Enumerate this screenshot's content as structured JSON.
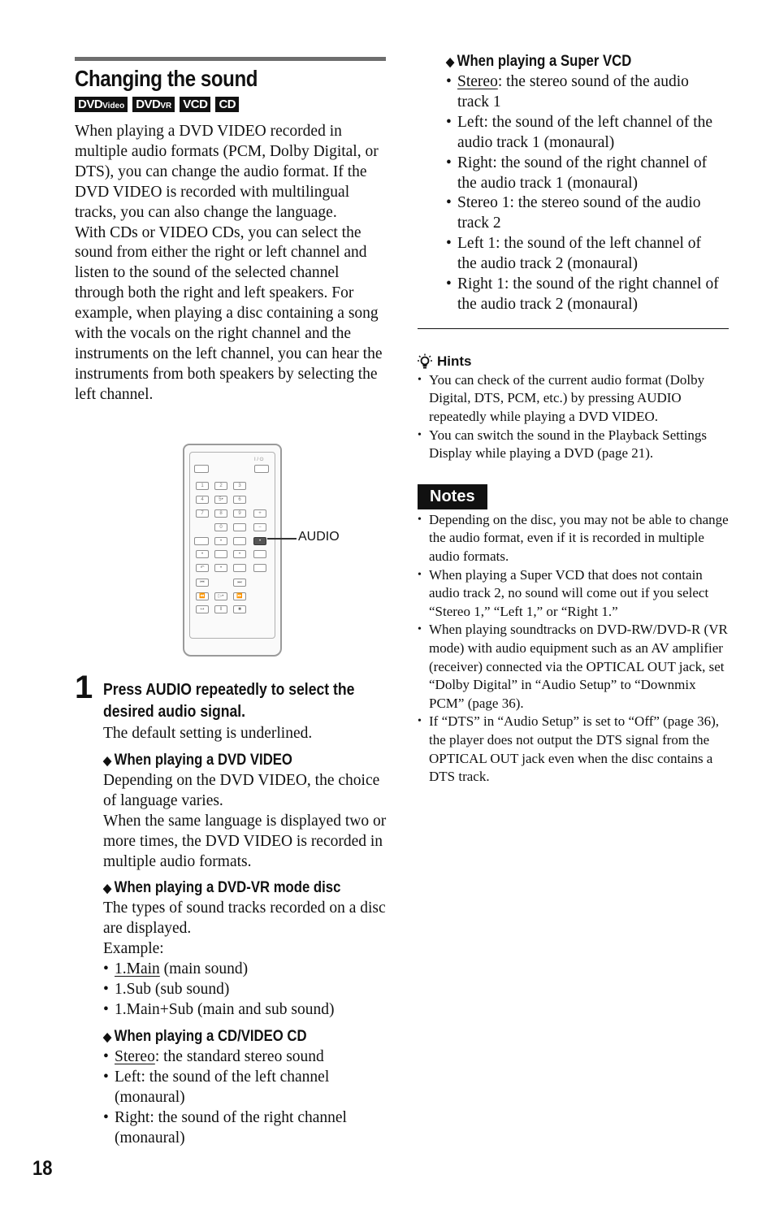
{
  "page": {
    "title": "Changing the sound",
    "page_number": "18",
    "disc_badges": [
      {
        "main": "DVD",
        "suffix": "Video"
      },
      {
        "main": "DVD",
        "suffix": "VR"
      },
      {
        "main": "VCD",
        "suffix": ""
      },
      {
        "main": "CD",
        "suffix": ""
      }
    ]
  },
  "intro": {
    "paragraph1": "When playing a DVD VIDEO recorded in multiple audio formats (PCM, Dolby Digital, or DTS), you can change the audio format. If the DVD VIDEO is recorded with multilingual tracks, you can also change the language.",
    "paragraph2": "With CDs or VIDEO CDs, you can select the sound from either the right or left channel and listen to the sound of the selected channel through both the right and left speakers. For example, when playing a disc containing a song with the vocals on the right channel and the instruments on the left channel, you can hear the instruments from both speakers by selecting the left channel."
  },
  "illustration": {
    "callout_label": "AUDIO",
    "power_label": "I / ⏻",
    "buttons": [
      "1",
      "2",
      "3",
      "4",
      "5•",
      "6",
      "7",
      "8",
      "9",
      "+",
      "0",
      "−",
      "•",
      "•",
      "•",
      "•",
      "•",
      "↶",
      "•",
      "⏮",
      "⏭",
      "⏪",
      "▷•",
      "⏩",
      "↦",
      "‖",
      "■"
    ]
  },
  "step1": {
    "number": "1",
    "title": "Press AUDIO repeatedly to select the desired audio signal.",
    "subtitle": "The default setting is underlined.",
    "dvd_video": {
      "heading": "When playing a DVD VIDEO",
      "text1": "Depending on the DVD VIDEO, the choice of language varies.",
      "text2": "When the same language is displayed two or more times, the DVD VIDEO is recorded in multiple audio formats."
    },
    "dvd_vr": {
      "heading": "When playing a DVD-VR mode disc",
      "text1": "The types of sound tracks recorded on a disc are displayed.",
      "text2": "Example:",
      "items": [
        {
          "term": "1.Main",
          "rest": " (main sound)",
          "default": true
        },
        {
          "term": "1.Sub",
          "rest": " (sub sound)",
          "default": false
        },
        {
          "term": "1.Main+Sub",
          "rest": " (main and sub sound)",
          "default": false
        }
      ]
    },
    "cd_vcd": {
      "heading": "When playing a CD/VIDEO CD",
      "items": [
        {
          "term": "Stereo",
          "rest": ": the standard stereo sound",
          "default": true
        },
        {
          "term": "Left",
          "rest": ": the sound of the left channel (monaural)",
          "default": false
        },
        {
          "term": "Right",
          "rest": ": the sound of the right channel (monaural)",
          "default": false
        }
      ]
    },
    "super_vcd": {
      "heading": "When playing a Super VCD",
      "items": [
        {
          "term": "Stereo",
          "rest": ": the stereo sound of the audio track 1",
          "default": true
        },
        {
          "term": "Left",
          "rest": ": the sound of the left channel of the audio track 1 (monaural)",
          "default": false
        },
        {
          "term": "Right",
          "rest": ": the sound of the right channel of the audio track 1 (monaural)",
          "default": false
        },
        {
          "term": "Stereo 1",
          "rest": ": the stereo sound of the audio track 2",
          "default": false
        },
        {
          "term": "Left 1",
          "rest": ": the sound of the left channel of the audio track 2 (monaural)",
          "default": false
        },
        {
          "term": "Right 1",
          "rest": ": the sound of the right channel of the audio track 2 (monaural)",
          "default": false
        }
      ]
    }
  },
  "hints": {
    "heading": "Hints",
    "items": [
      "You can check of the current audio format (Dolby Digital, DTS, PCM, etc.) by pressing AUDIO repeatedly while playing a DVD VIDEO.",
      "You can switch the sound in the Playback Settings Display while playing a DVD (page 21)."
    ]
  },
  "notes": {
    "heading": "Notes",
    "items": [
      "Depending on the disc, you may not be able to change the audio format, even if it is recorded in multiple audio formats.",
      "When playing a Super VCD that does not contain audio track 2, no sound will come out if you select “Stereo 1,” “Left 1,” or “Right 1.”",
      "When playing soundtracks on DVD-RW/DVD-R (VR mode) with audio equipment such as an AV amplifier (receiver) connected via the OPTICAL OUT jack, set “Dolby Digital” in “Audio Setup” to “Downmix PCM” (page 36).",
      "If “DTS” in “Audio Setup” is set to “Off” (page 36), the player does not output the DTS signal from the OPTICAL OUT jack even when the disc contains a DTS track."
    ]
  }
}
